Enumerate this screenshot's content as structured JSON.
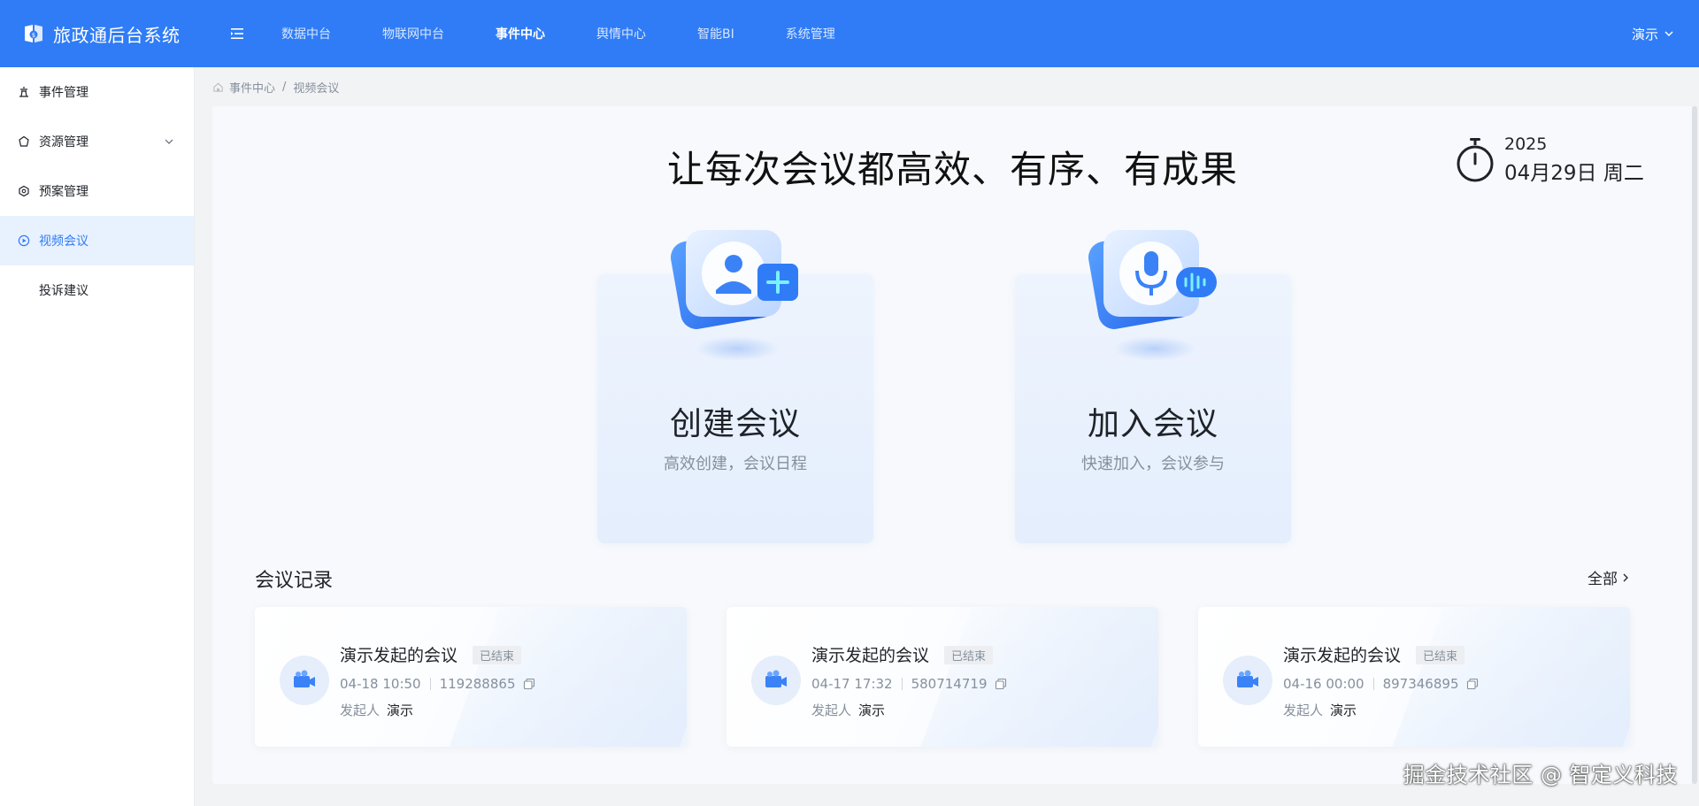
{
  "app": {
    "title": "旅政通后台系统"
  },
  "nav": {
    "items": [
      {
        "label": "数据中台",
        "active": false
      },
      {
        "label": "物联网中台",
        "active": false
      },
      {
        "label": "事件中心",
        "active": true
      },
      {
        "label": "舆情中心",
        "active": false
      },
      {
        "label": "智能BI",
        "active": false
      },
      {
        "label": "系统管理",
        "active": false
      }
    ],
    "user": "演示"
  },
  "sidebar": {
    "items": [
      {
        "label": "事件管理",
        "icon": "event-icon"
      },
      {
        "label": "资源管理",
        "icon": "resource-icon"
      },
      {
        "label": "预案管理",
        "icon": "plan-icon"
      },
      {
        "label": "视频会议",
        "icon": "video-icon",
        "active": true
      },
      {
        "label": "投诉建议"
      }
    ]
  },
  "breadcrumb": {
    "home_icon": "home-icon",
    "root": "事件中心",
    "separator": "/",
    "current": "视频会议"
  },
  "main": {
    "slogan": "让每次会议都高效、有序、有成果",
    "date": {
      "year": "2025",
      "day": "04月29日 周二"
    },
    "actions": [
      {
        "title": "创建会议",
        "desc": "高效创建，会议日程",
        "icon": "create-meeting-icon"
      },
      {
        "title": "加入会议",
        "desc": "快速加入，会议参与",
        "icon": "join-meeting-icon"
      }
    ],
    "records": {
      "title": "会议记录",
      "all_label": "全部",
      "host_label": "发起人",
      "items": [
        {
          "name": "演示发起的会议",
          "status": "已结束",
          "time": "04-18 10:50",
          "id": "119288865",
          "host": "演示"
        },
        {
          "name": "演示发起的会议",
          "status": "已结束",
          "time": "04-17 17:32",
          "id": "580714719",
          "host": "演示"
        },
        {
          "name": "演示发起的会议",
          "status": "已结束",
          "time": "04-16 00:00",
          "id": "897346895",
          "host": "演示"
        }
      ]
    }
  },
  "watermark": "掘金技术社区 @ 智定义科技",
  "colors": {
    "primary": "#2f7cf6",
    "sidebar_active_bg": "#e8f1fe"
  }
}
